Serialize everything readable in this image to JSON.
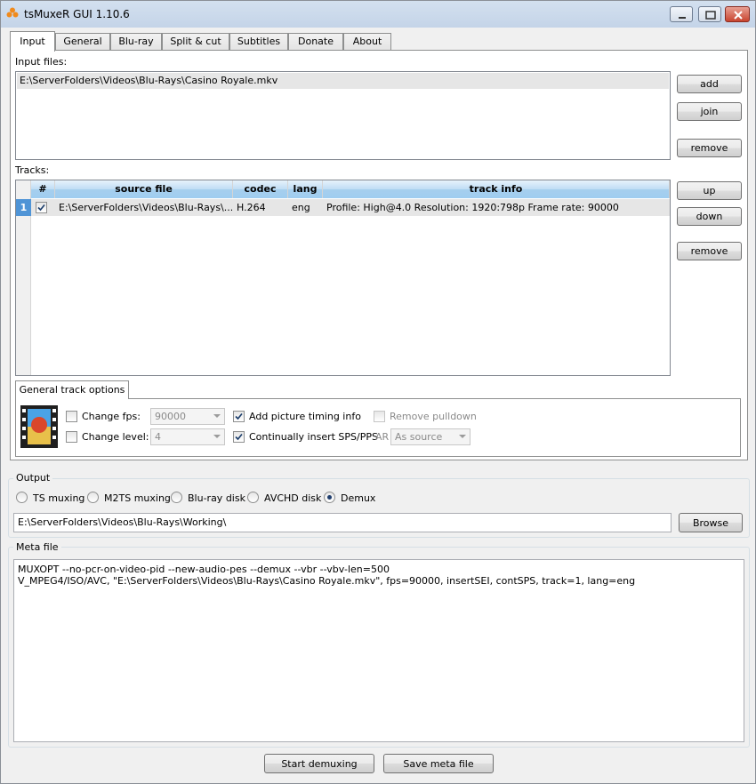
{
  "window": {
    "title": "tsMuxeR GUI 1.10.6",
    "controls": [
      "minimize-icon",
      "maximize-icon",
      "close-icon"
    ]
  },
  "tabs": [
    "Input",
    "General",
    "Blu-ray",
    "Split & cut",
    "Subtitles",
    "Donate",
    "About"
  ],
  "active_tab": "Input",
  "input_files": {
    "label": "Input files:",
    "items": [
      "E:\\ServerFolders\\Videos\\Blu-Rays\\Casino Royale.mkv"
    ],
    "add_label": "add",
    "join_label": "join",
    "remove_label": "remove"
  },
  "tracks": {
    "label": "Tracks:",
    "columns": [
      "#",
      "source file",
      "codec",
      "lang",
      "track info"
    ],
    "rows": [
      {
        "index": "1",
        "checked": true,
        "source_file": "E:\\ServerFolders\\Videos\\Blu-Rays\\...",
        "codec": "H.264",
        "lang": "eng",
        "track_info": "Profile: High@4.0  Resolution: 1920:798p  Frame rate: 90000"
      }
    ],
    "up_label": "up",
    "down_label": "down",
    "remove_label": "remove"
  },
  "track_options": {
    "tab_label": "General track options",
    "change_fps_label": "Change fps:",
    "fps_value": "90000",
    "change_level_label": "Change level:",
    "level_value": "4",
    "add_picture_timing_label": "Add picture timing info",
    "continually_insert_label": "Continually insert SPS/PPS",
    "remove_pulldown_label": "Remove pulldown",
    "ar_label": "AR",
    "ar_value": "As source"
  },
  "output": {
    "label": "Output",
    "modes": [
      "TS muxing",
      "M2TS muxing",
      "Blu-ray disk",
      "AVCHD disk",
      "Demux"
    ],
    "selected_mode": "Demux",
    "path": "E:\\ServerFolders\\Videos\\Blu-Rays\\Working\\",
    "browse_label": "Browse"
  },
  "meta_file": {
    "label": "Meta file",
    "lines": [
      "MUXOPT --no-pcr-on-video-pid --new-audio-pes --demux --vbr  --vbv-len=500",
      "V_MPEG4/ISO/AVC, \"E:\\ServerFolders\\Videos\\Blu-Rays\\Casino Royale.mkv\", fps=90000, insertSEI, contSPS, track=1, lang=eng"
    ]
  },
  "actions": {
    "start_label": "Start demuxing",
    "save_meta_label": "Save meta file"
  },
  "colors": {
    "selection_row": "#e6e6e6",
    "header_blue": "#9fcdf0",
    "window_bg": "#f0f0f0"
  }
}
